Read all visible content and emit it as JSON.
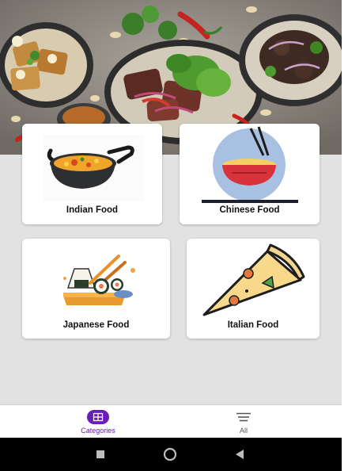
{
  "categories": [
    {
      "id": "indian",
      "label": "Indian Food",
      "icon": "kadai-curry-icon"
    },
    {
      "id": "chinese",
      "label": "Chinese Food",
      "icon": "noodle-bowl-icon"
    },
    {
      "id": "japanese",
      "label": "Japanese Food",
      "icon": "sushi-icon"
    },
    {
      "id": "italian",
      "label": "Italian Food",
      "icon": "pizza-slice-icon"
    }
  ],
  "bottom_nav": {
    "categories_label": "Categories",
    "all_label": "All",
    "active": "Categories"
  },
  "system_nav": {
    "recents_icon": "square-recents-icon",
    "home_icon": "circle-home-icon",
    "back_icon": "triangle-back-icon"
  },
  "colors": {
    "accent": "#6a1bb8",
    "background": "#e2e2e2",
    "card": "#ffffff",
    "system_bar": "#000000"
  }
}
